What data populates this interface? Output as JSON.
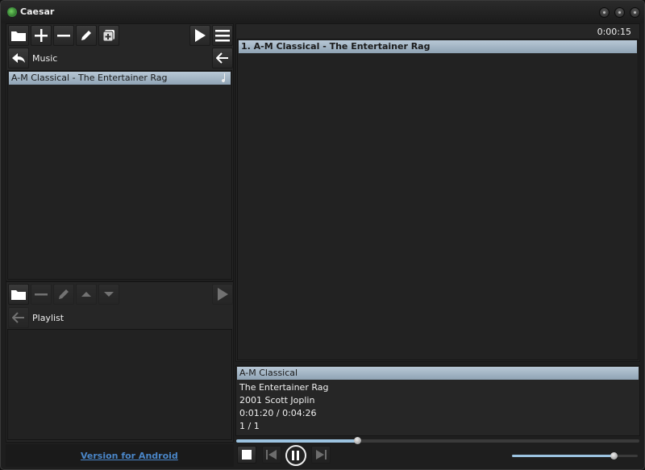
{
  "window": {
    "title": "Caesar"
  },
  "browser": {
    "header_label": "Music",
    "items": [
      {
        "label": "A-M Classical - The Entertainer Rag"
      }
    ]
  },
  "playlist_panel": {
    "header_label": "Playlist"
  },
  "footer": {
    "android_link": "Version for Android"
  },
  "now_playing": {
    "elapsed": "0:00:15",
    "queue": [
      {
        "label": "1. A-M Classical - The Entertainer Rag"
      }
    ],
    "info": {
      "artist": "A-M Classical",
      "title": "The Entertainer Rag",
      "year_composer": "2001 Scott Joplin",
      "time": "0:01:20 / 0:04:26",
      "track_count": "1 / 1"
    }
  },
  "playback": {
    "progress_fraction": 0.3,
    "volume_fraction": 0.81
  },
  "colors": {
    "selection": "#a8bac9",
    "accent": "#9cc3e0",
    "link": "#4a86c8"
  },
  "icons": [
    "folder-icon",
    "plus-icon",
    "minus-icon",
    "pencil-icon",
    "add-copy-icon",
    "play-icon",
    "menu-icon",
    "back-icon",
    "left-arrow-icon",
    "music-note-icon",
    "up-arrow-icon",
    "down-arrow-icon",
    "stop-icon",
    "previous-icon",
    "pause-icon",
    "next-icon"
  ]
}
